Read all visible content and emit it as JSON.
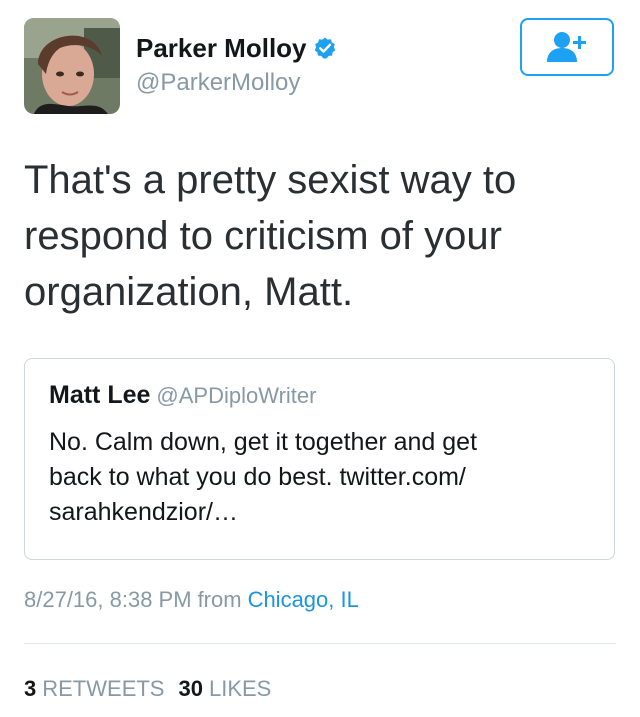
{
  "author": {
    "display_name": "Parker Molloy",
    "handle": "@ParkerMolloy",
    "verified_icon": "verified-badge-icon",
    "avatar": "profile-photo"
  },
  "follow_button": {
    "icon": "follow-user-icon"
  },
  "tweet": {
    "text_lines": [
      "That's a pretty sexist way to",
      "respond to criticism of your",
      "organization, Matt."
    ]
  },
  "quoted_tweet": {
    "name": "Matt Lee",
    "handle": "@APDiploWriter",
    "text_lines": [
      "No. Calm down, get it together and get",
      "back to what you do best. twitter.com/",
      "sarahkendzior/…"
    ]
  },
  "meta": {
    "timestamp": "8/27/16, 8:38 PM",
    "from_label": "from",
    "location": "Chicago, IL"
  },
  "stats": {
    "retweets_count": "3",
    "retweets_label": "RETWEETS",
    "likes_count": "30",
    "likes_label": "LIKES"
  },
  "colors": {
    "accent": "#1da1f2",
    "link": "#1b95e0",
    "secondary_text": "#8899a6",
    "border": "#ccd6dd"
  }
}
